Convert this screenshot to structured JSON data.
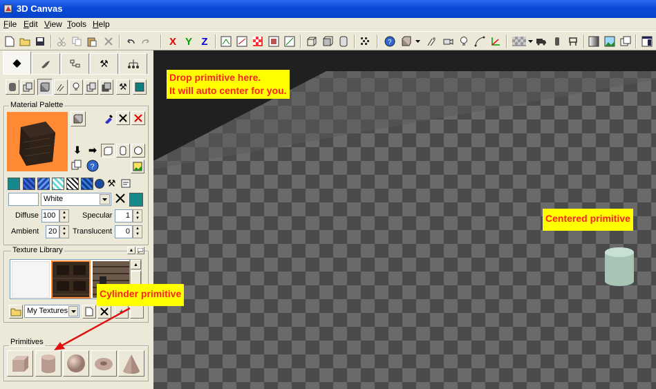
{
  "window": {
    "title": "3D Canvas"
  },
  "menu": [
    {
      "label_u": "F",
      "label_rest": "ile"
    },
    {
      "label_u": "E",
      "label_rest": "dit"
    },
    {
      "label_u": "V",
      "label_rest": "iew"
    },
    {
      "label_u": "T",
      "label_rest": "ools"
    },
    {
      "label_u": "H",
      "label_rest": "elp"
    }
  ],
  "toolbar": {
    "axis_x": "X",
    "axis_y": "Y",
    "axis_z": "Z"
  },
  "material_palette": {
    "label": "Material Palette",
    "color_name": "White",
    "diffuse_label": "Diffuse",
    "diffuse_value": "100",
    "specular_label": "Specular",
    "specular_value": "1",
    "ambient_label": "Ambient",
    "ambient_value": "20",
    "translucent_label": "Translucent",
    "translucent_value": "0"
  },
  "texture_library": {
    "label": "Texture Library",
    "folder": "My Textures"
  },
  "primitives": {
    "label": "Primitives"
  },
  "annotations": {
    "drop_line1": "Drop primitive here.",
    "drop_line2": "It will auto center for you.",
    "centered": "Centered primitive",
    "cylinder": "Cylinder primitive"
  },
  "colors": {
    "title_bar": "#0a4ad8",
    "annotation_bg": "#ffff00",
    "annotation_text": "#ff2020",
    "swatch_orange": "#ff8a33"
  }
}
